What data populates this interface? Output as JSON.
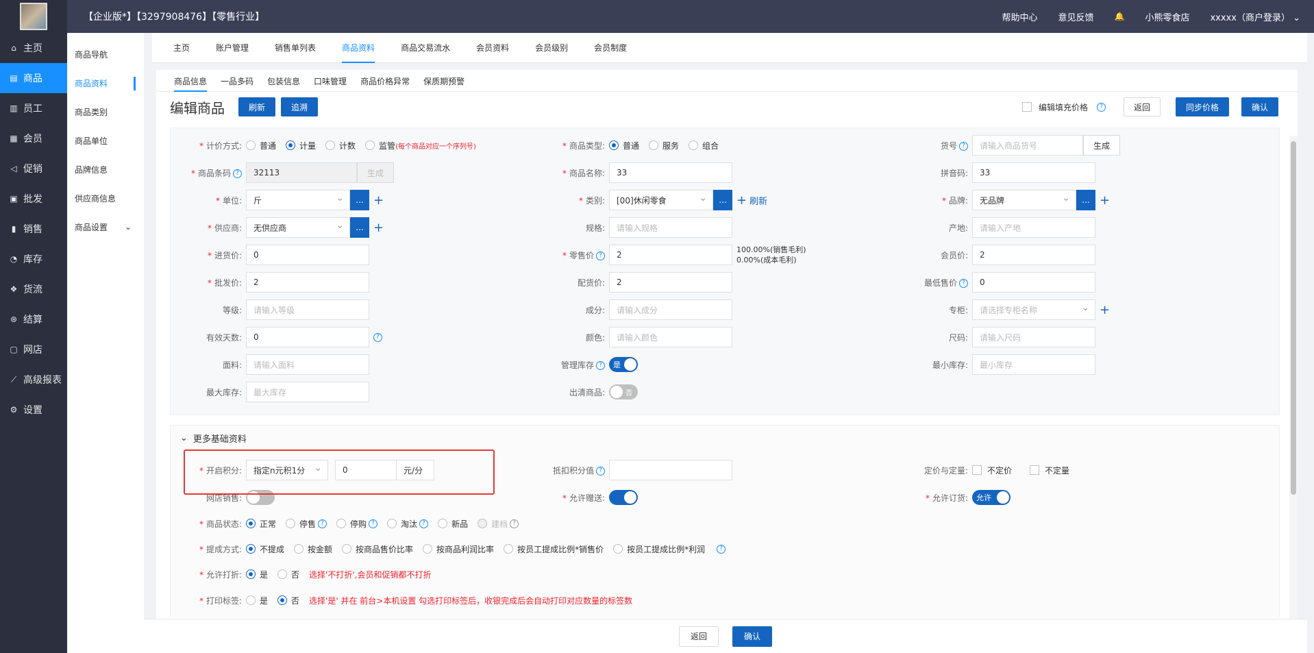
{
  "nav": {
    "items": [
      {
        "icon": "⌂",
        "label": "主页"
      },
      {
        "icon": "▤",
        "label": "商品",
        "active": true
      },
      {
        "icon": "▥",
        "label": "员工"
      },
      {
        "icon": "▦",
        "label": "会员"
      },
      {
        "icon": "◁",
        "label": "促销"
      },
      {
        "icon": "▣",
        "label": "批发"
      },
      {
        "icon": "▮",
        "label": "销售"
      },
      {
        "icon": "◔",
        "label": "库存"
      },
      {
        "icon": "❖",
        "label": "货流"
      },
      {
        "icon": "⊛",
        "label": "结算"
      },
      {
        "icon": "▢",
        "label": "网店"
      },
      {
        "icon": "⟋",
        "label": "高级报表"
      },
      {
        "icon": "⚙",
        "label": "设置"
      }
    ]
  },
  "topbar": {
    "title": "【企业版*】【3297908476】【零售行业】",
    "help": "帮助中心",
    "feedback": "意见反馈",
    "bell": "🔔",
    "shop": "小熊零食店",
    "user": "xxxxx（商户登录）",
    "chev": "⌄"
  },
  "subnav": {
    "items": [
      "商品导航",
      "商品资料",
      "商品类别",
      "商品单位",
      "品牌信息",
      "供应商信息",
      "商品设置"
    ],
    "settings_chev": "⌄"
  },
  "tabs1": [
    "主页",
    "账户管理",
    "销售单列表",
    "商品资料",
    "商品交易流水",
    "会员资料",
    "会员级别",
    "会员制度"
  ],
  "tabs2": [
    "商品信息",
    "一品多码",
    "包装信息",
    "口味管理",
    "商品价格异常",
    "保质期预警"
  ],
  "header": {
    "title": "编辑商品",
    "refresh": "刷新",
    "trace": "追溯",
    "edit_fill": "编辑填充价格",
    "back": "返回",
    "sync": "同步价格",
    "confirm": "确认",
    "q": "?"
  },
  "sym": {
    "req": "*",
    "q": "?",
    "dots": "...",
    "plus": "+"
  },
  "form": {
    "pricing_mode": {
      "label": "计价方式:",
      "options": [
        "普通",
        "计量",
        "计数",
        "监管"
      ],
      "note": "(每个商品对应一个序列号)"
    },
    "product_type": {
      "label": "商品类型:",
      "options": [
        "普通",
        "服务",
        "组合"
      ]
    },
    "item_no": {
      "label": "货号",
      "placeholder": "请输入商品货号",
      "gen": "生成"
    },
    "barcode": {
      "label": "商品条码",
      "value": "32113",
      "gen": "生成"
    },
    "name": {
      "label": "商品名称:",
      "value": "33"
    },
    "pinyin": {
      "label": "拼音码:",
      "value": "33"
    },
    "unit": {
      "label": "单位:",
      "value": "斤"
    },
    "category": {
      "label": "类别:",
      "value": "[00]休闲零食",
      "refresh": "刷新"
    },
    "brand": {
      "label": "品牌:",
      "value": "无品牌"
    },
    "supplier": {
      "label": "供应商:",
      "value": "无供应商"
    },
    "spec": {
      "label": "规格:",
      "placeholder": "请输入规格"
    },
    "origin": {
      "label": "产地:",
      "placeholder": "请输入产地"
    },
    "purchase": {
      "label": "进货价:",
      "value": "0"
    },
    "retail": {
      "label": "零售价",
      "value": "2",
      "margin1": "100.00%(销售毛利)",
      "margin2": "0.00%(成本毛利)"
    },
    "member_price": {
      "label": "会员价:",
      "value": "2"
    },
    "wholesale": {
      "label": "批发价:",
      "value": "2"
    },
    "dist_price": {
      "label": "配货价:",
      "value": "2"
    },
    "min_price": {
      "label": "最低售价",
      "value": "0"
    },
    "grade": {
      "label": "等级:",
      "placeholder": "请输入等级"
    },
    "ingredient": {
      "label": "成分:",
      "placeholder": "请输入成分"
    },
    "counter": {
      "label": "专柜:",
      "placeholder": "请选择专柜名称"
    },
    "valid_days": {
      "label": "有效天数:",
      "value": "0"
    },
    "color": {
      "label": "颜色:",
      "placeholder": "请输入颜色"
    },
    "size": {
      "label": "尺码:",
      "placeholder": "请输入尺码"
    },
    "fabric": {
      "label": "面料:",
      "placeholder": "请输入面料"
    },
    "manage_stock": {
      "label": "管理库存",
      "state": "是"
    },
    "min_stock": {
      "label": "最小库存:",
      "placeholder": "最小库存"
    },
    "max_stock": {
      "label": "最大库存:",
      "placeholder": "最大库存"
    },
    "clearance": {
      "label": "出清商品:",
      "state": "否"
    }
  },
  "more": {
    "title": "更多基础资料",
    "chev": "⌄",
    "points": {
      "label": "开启积分:",
      "mode": "指定n元积1分",
      "value": "0",
      "unit": "元/分"
    },
    "deduct": {
      "label": "抵扣积分值"
    },
    "fixed": {
      "label": "定价与定量:",
      "opt1": "不定价",
      "opt2": "不定量"
    },
    "online": {
      "label": "网店销售:"
    },
    "gift": {
      "label": "允许赠送:"
    },
    "order": {
      "label": "允许订货:",
      "state": "允许"
    },
    "status": {
      "label": "商品状态:",
      "options": [
        "正常",
        "停售",
        "停购",
        "淘汰",
        "新品",
        "建档"
      ]
    },
    "commission": {
      "label": "提成方式:",
      "options": [
        "不提成",
        "按金额",
        "按商品售价比率",
        "按商品利润比率",
        "按员工提成比例*销售价",
        "按员工提成比例*利润"
      ]
    },
    "discount": {
      "label": "允许打折:",
      "yes": "是",
      "no": "否",
      "hint": "选择'不打折',会员和促销都不打折"
    },
    "print_label": {
      "label": "打印标签:",
      "yes": "是",
      "no": "否",
      "hint": "选择'是' 并在 前台>本机设置 勾选打印标签后，收银完成后会自动打印对应数量的标签数"
    }
  },
  "footer": {
    "back": "返回",
    "confirm": "确认"
  }
}
